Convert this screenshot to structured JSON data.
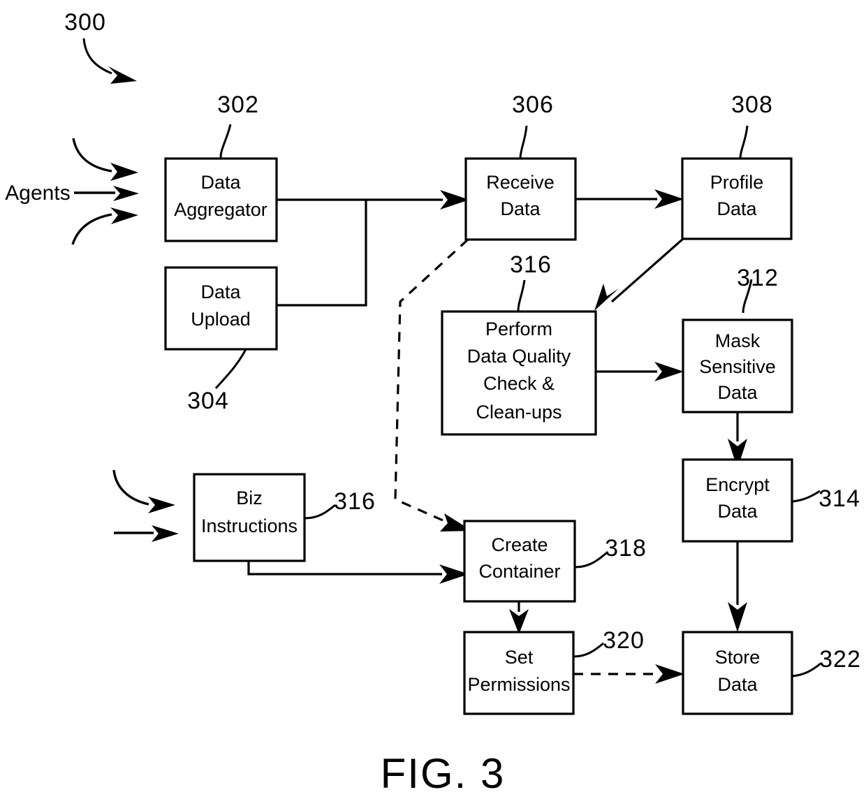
{
  "figure": {
    "caption": "FIG. 3",
    "diagram_ref": "300",
    "input_label": "Agents"
  },
  "nodes": [
    {
      "id": "data_aggregator",
      "lines": [
        "Data",
        "Aggregator"
      ],
      "ref": "302"
    },
    {
      "id": "data_upload",
      "lines": [
        "Data",
        "Upload"
      ],
      "ref": "304"
    },
    {
      "id": "receive_data",
      "lines": [
        "Receive",
        "Data"
      ],
      "ref": "306"
    },
    {
      "id": "profile_data",
      "lines": [
        "Profile",
        "Data"
      ],
      "ref": "308"
    },
    {
      "id": "data_quality",
      "lines": [
        "Perform",
        "Data Quality",
        "Check &",
        "Clean-ups"
      ],
      "ref": "316"
    },
    {
      "id": "mask_sensitive",
      "lines": [
        "Mask",
        "Sensitive",
        "Data"
      ],
      "ref": "312"
    },
    {
      "id": "encrypt_data",
      "lines": [
        "Encrypt",
        "Data"
      ],
      "ref": "314"
    },
    {
      "id": "biz_instructions",
      "lines": [
        "Biz",
        "Instructions"
      ],
      "ref": "316"
    },
    {
      "id": "create_container",
      "lines": [
        "Create",
        "Container"
      ],
      "ref": "318"
    },
    {
      "id": "set_permissions",
      "lines": [
        "Set",
        "Permissions"
      ],
      "ref": "320"
    },
    {
      "id": "store_data",
      "lines": [
        "Store",
        "Data"
      ],
      "ref": "322"
    }
  ],
  "colors": {
    "ink": "#000000",
    "paper": "#ffffff"
  }
}
